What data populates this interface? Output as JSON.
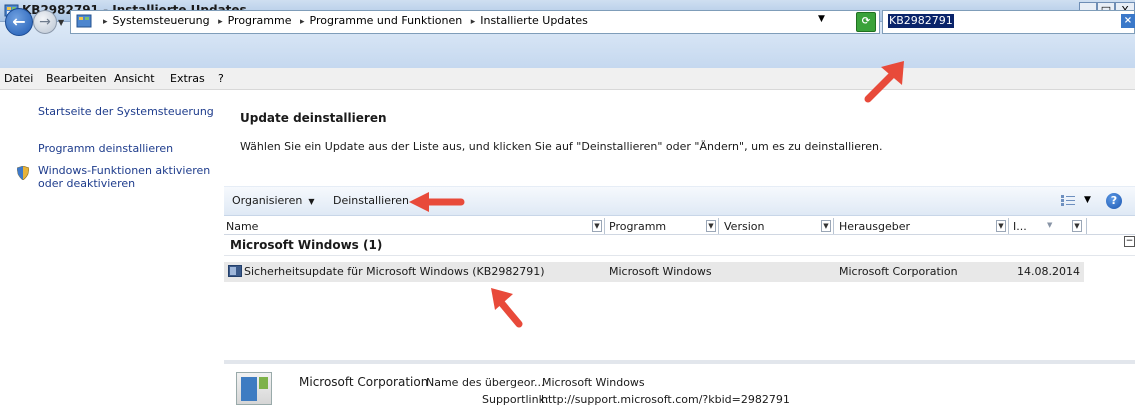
{
  "window": {
    "title": "KB2982791 - Installierte Updates",
    "controls": {
      "minimize": "_",
      "maximize": "□",
      "close": "X"
    }
  },
  "address_bar": {
    "breadcrumbs": [
      "Systemsteuerung",
      "Programme",
      "Programme und Funktionen",
      "Installierte Updates"
    ],
    "search_value": "KB2982791"
  },
  "menu": [
    "Datei",
    "Bearbeiten",
    "Ansicht",
    "Extras",
    "?"
  ],
  "left_panel": {
    "home_link": "Startseite der Systemsteuerung",
    "uninstall_link": "Programm deinstallieren",
    "features_link_line1": "Windows-Funktionen aktivieren",
    "features_link_line2": "oder deaktivieren"
  },
  "content": {
    "title": "Update deinstallieren",
    "description": "Wählen Sie ein Update aus der Liste aus, und klicken Sie auf \"Deinstallieren\" oder \"Ändern\", um es zu deinstallieren."
  },
  "toolbar": {
    "organize_label": "Organisieren",
    "uninstall_label": "Deinstallieren",
    "help_glyph": "?"
  },
  "columns": {
    "name": "Name",
    "program": "Programm",
    "version": "Version",
    "publisher": "Herausgeber",
    "installed": "I..."
  },
  "group": {
    "label": "Microsoft Windows (1)",
    "toggle": "−"
  },
  "rows": [
    {
      "name": "Sicherheitsupdate für Microsoft Windows (KB2982791)",
      "program": "Microsoft Windows",
      "publisher": "Microsoft Corporation",
      "installed": "14.08.2014"
    }
  ],
  "details": {
    "company": "Microsoft Corporation",
    "parent_label": "Name des übergeor...",
    "parent_value": "Microsoft Windows",
    "support_label": "Supportlink:",
    "support_value": "http://support.microsoft.com/?kbid=2982791"
  },
  "colors": {
    "link": "#1e3c8c",
    "annotation_arrow": "#e84a3a",
    "selection": "#0a246a"
  }
}
